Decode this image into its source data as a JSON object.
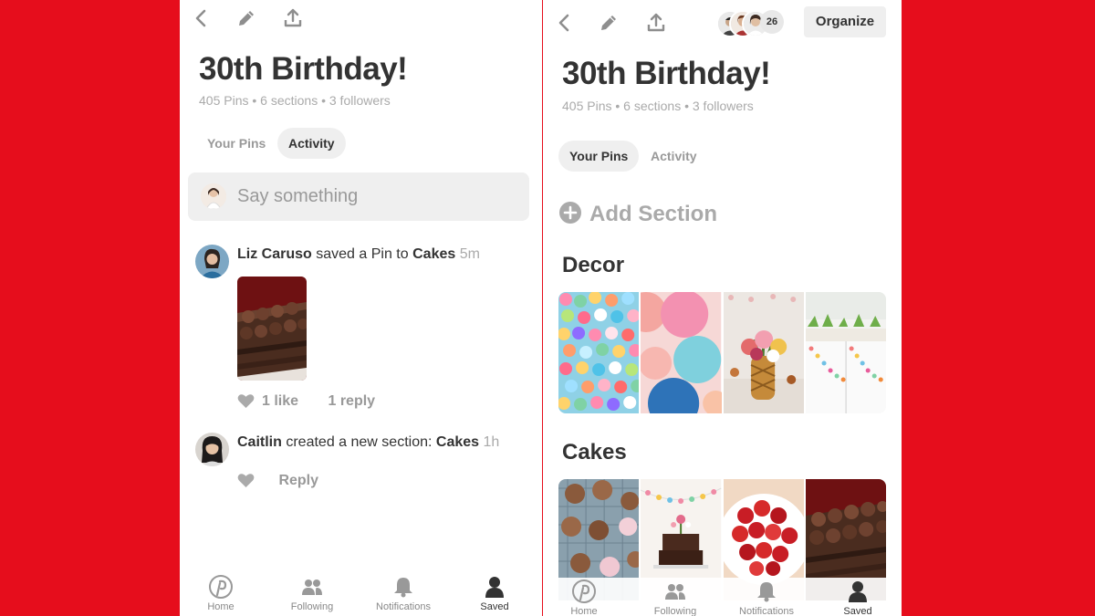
{
  "board": {
    "title": "30th Birthday!",
    "meta": "405 Pins • 6 sections • 3 followers"
  },
  "left_screen": {
    "tabs": [
      "Your Pins",
      "Activity"
    ],
    "active_tab": "Activity",
    "comment_placeholder": "Say something",
    "activities": [
      {
        "user": "Liz Caruso",
        "action": "saved a Pin to",
        "target": "Cakes",
        "time": "5m",
        "likes": "1 like",
        "replies": "1 reply"
      },
      {
        "user": "Caitlin",
        "action": "created a new section:",
        "target": "Cakes",
        "time": "1h",
        "reply_label": "Reply"
      }
    ]
  },
  "right_screen": {
    "tabs": [
      "Your Pins",
      "Activity"
    ],
    "active_tab": "Your Pins",
    "collaborator_count": "26",
    "organize_label": "Organize",
    "add_section_label": "Add Section",
    "sections": [
      "Decor",
      "Cakes"
    ]
  },
  "bottom_nav": [
    "Home",
    "Following",
    "Notifications",
    "Saved"
  ],
  "active_nav": "Saved",
  "icons": {
    "back": "chevron-left-icon",
    "edit": "pencil-icon",
    "share": "share-icon",
    "heart": "heart-icon",
    "home": "pinterest-logo-icon",
    "following": "people-icon",
    "notifications": "bell-icon",
    "saved": "person-icon"
  },
  "colors": {
    "background": "#e60d1c",
    "tab_active_bg": "#efefef",
    "muted_text": "#aaaaaa"
  }
}
